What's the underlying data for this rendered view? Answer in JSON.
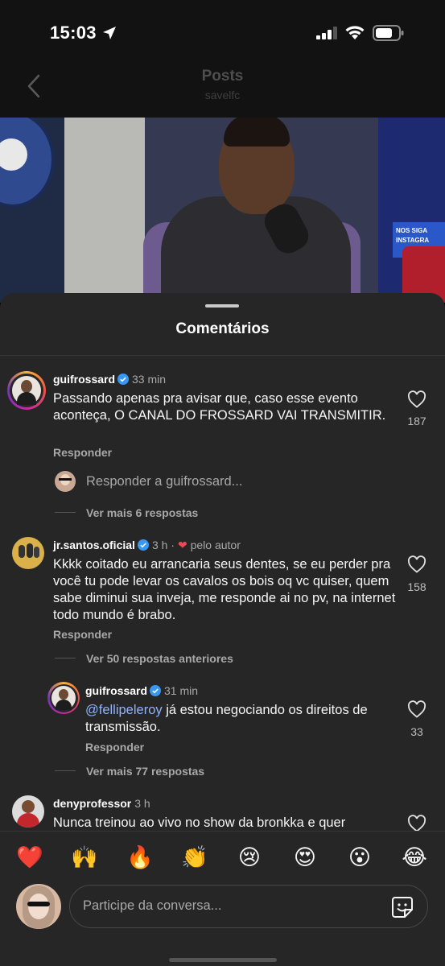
{
  "status_bar": {
    "time": "15:03"
  },
  "header": {
    "title": "Posts",
    "subtitle": "savelfc"
  },
  "video": {
    "banner_text": "NOS SIGA INSTAGRA"
  },
  "sheet": {
    "title": "Comentários"
  },
  "comments": [
    {
      "username": "guifrossard",
      "time": "33 min",
      "text": "Passando apenas pra avisar que, caso esse evento aconteça, O CANAL DO FROSSARD VAI TRANSMITIR.",
      "likes": "187",
      "reply_label": "Responder",
      "reply_prompt": "Responder a guifrossard...",
      "more": "Ver mais 6 respostas"
    },
    {
      "username": "jr.santos.oficial",
      "time": "3 h",
      "separator": "·",
      "author_like": "pelo autor",
      "text": "Kkkk coitado eu arrancaria  seus dentes, se eu perder pra você tu pode levar os cavalos os bois oq vc quiser, quem sabe diminui sua inveja, me responde ai no pv, na internet todo mundo é brabo.",
      "likes": "158",
      "reply_label": "Responder",
      "previous": "Ver 50 respostas anteriores"
    },
    {
      "username": "guifrossard",
      "time": "31 min",
      "mention": "@fellipeleroy",
      "text": " já estou negociando os direitos de transmissão.",
      "likes": "33",
      "reply_label": "Responder",
      "more": "Ver mais 77 respostas"
    },
    {
      "username": "denyprofessor",
      "time": "3 h",
      "text": "Nunca treinou ao vivo no show da bronkka e quer"
    }
  ],
  "emoji_bar": [
    "❤️",
    "🙌",
    "🔥",
    "👏",
    "😢",
    "😍",
    "😮",
    "😂"
  ],
  "input": {
    "placeholder": "Participe da conversa..."
  },
  "colors": {
    "background": "#262626",
    "mention": "#8fb4ff",
    "verified": "#3897f0",
    "like_red": "#ed4956"
  }
}
